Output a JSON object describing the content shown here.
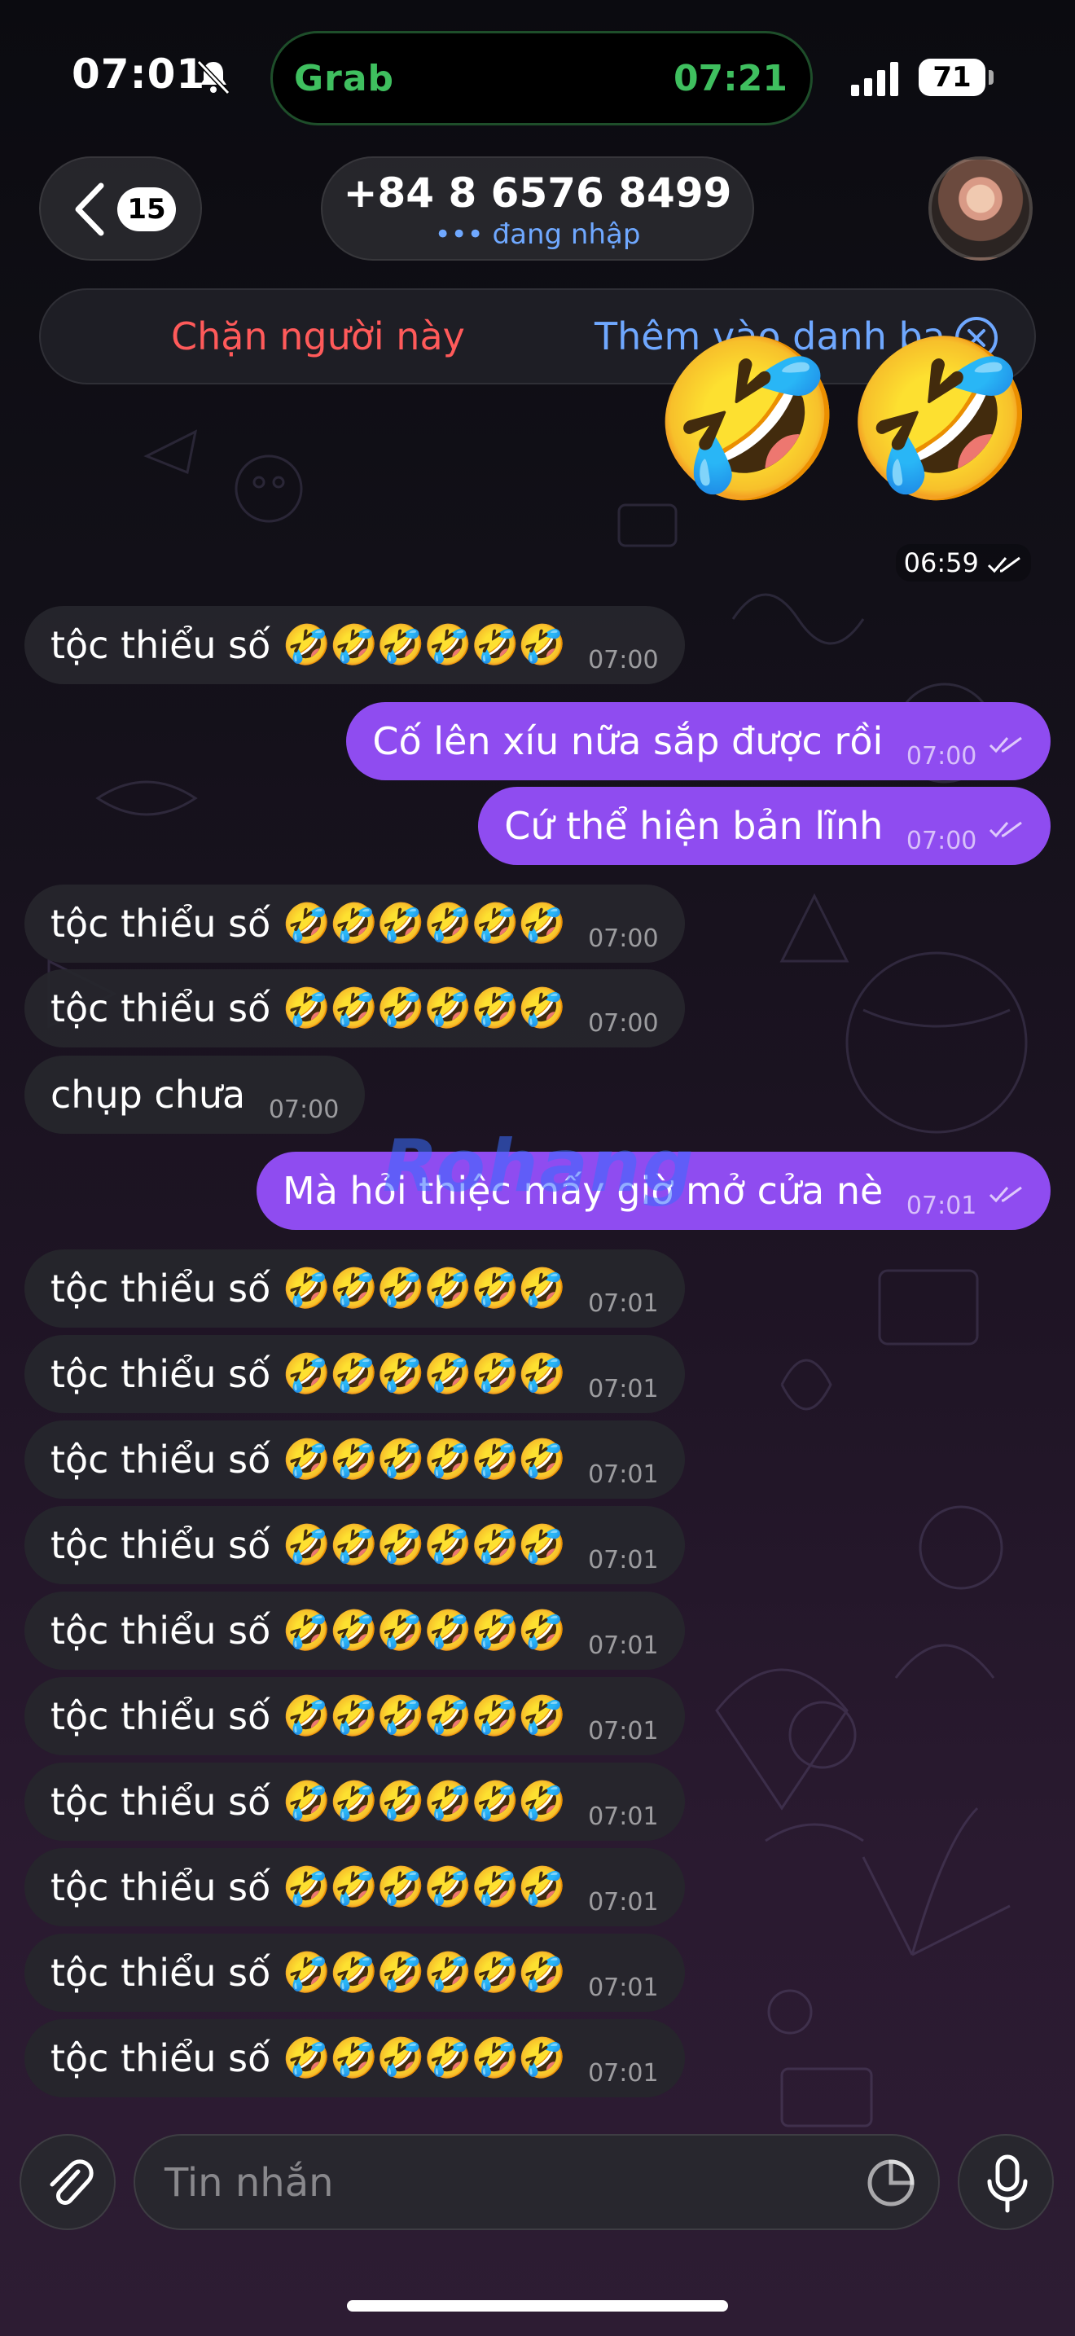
{
  "status_bar": {
    "time": "07:01",
    "live_activity_app": "Grab",
    "live_activity_time": "07:21",
    "battery": "71"
  },
  "header": {
    "back_count": "15",
    "phone": "+84 8 6576 8499",
    "status": "đang nhập"
  },
  "actions": {
    "block": "Chặn người này",
    "add_contact": "Thêm vào danh bạ"
  },
  "top_message": {
    "emojis": "🤣🤣",
    "time": "06:59"
  },
  "messages": [
    {
      "dir": "in",
      "text": "tộc thiểu số",
      "emoji": "🤣🤣🤣🤣🤣🤣",
      "time": "07:00"
    },
    {
      "dir": "out",
      "text": "Cố lên xíu nữa sắp được rồi",
      "emoji": "",
      "time": "07:00"
    },
    {
      "dir": "out",
      "text": "Cứ thể hiện bản lĩnh",
      "emoji": "",
      "time": "07:00"
    },
    {
      "dir": "in",
      "text": "tộc thiểu số",
      "emoji": "🤣🤣🤣🤣🤣🤣",
      "time": "07:00"
    },
    {
      "dir": "in",
      "text": "tộc thiểu số",
      "emoji": "🤣🤣🤣🤣🤣🤣",
      "time": "07:00"
    },
    {
      "dir": "in",
      "text": "chụp chưa",
      "emoji": "",
      "time": "07:00"
    },
    {
      "dir": "out",
      "text": "Mà hỏi thiệc mấy giờ mở cửa nè",
      "emoji": "",
      "time": "07:01"
    },
    {
      "dir": "in",
      "text": "tộc thiểu số",
      "emoji": "🤣🤣🤣🤣🤣🤣",
      "time": "07:01"
    },
    {
      "dir": "in",
      "text": "tộc thiểu số",
      "emoji": "🤣🤣🤣🤣🤣🤣",
      "time": "07:01"
    },
    {
      "dir": "in",
      "text": "tộc thiểu số",
      "emoji": "🤣🤣🤣🤣🤣🤣",
      "time": "07:01"
    },
    {
      "dir": "in",
      "text": "tộc thiểu số",
      "emoji": "🤣🤣🤣🤣🤣🤣",
      "time": "07:01"
    },
    {
      "dir": "in",
      "text": "tộc thiểu số",
      "emoji": "🤣🤣🤣🤣🤣🤣",
      "time": "07:01"
    },
    {
      "dir": "in",
      "text": "tộc thiểu số",
      "emoji": "🤣🤣🤣🤣🤣🤣",
      "time": "07:01"
    },
    {
      "dir": "in",
      "text": "tộc thiểu số",
      "emoji": "🤣🤣🤣🤣🤣🤣",
      "time": "07:01"
    },
    {
      "dir": "in",
      "text": "tộc thiểu số",
      "emoji": "🤣🤣🤣🤣🤣🤣",
      "time": "07:01"
    },
    {
      "dir": "in",
      "text": "tộc thiểu số",
      "emoji": "🤣🤣🤣🤣🤣🤣",
      "time": "07:01"
    },
    {
      "dir": "in",
      "text": "tộc thiểu số",
      "emoji": "🤣🤣🤣🤣🤣🤣",
      "time": "07:01"
    }
  ],
  "watermark": {
    "part1": "Ro",
    "part2": "hang"
  },
  "composer": {
    "placeholder": "Tin nhắn"
  },
  "colors": {
    "outgoing_bubble": "#8f4cf0",
    "incoming_bubble": "#26262c",
    "block_text": "#ff5a5a",
    "link_text": "#6fa8ff",
    "live_activity": "#3fbf5f"
  },
  "icons": [
    "bell-slash-icon",
    "signal-icon",
    "chevron-left-icon",
    "close-circle-icon",
    "double-check-icon",
    "paperclip-icon",
    "sticker-icon",
    "microphone-icon"
  ]
}
